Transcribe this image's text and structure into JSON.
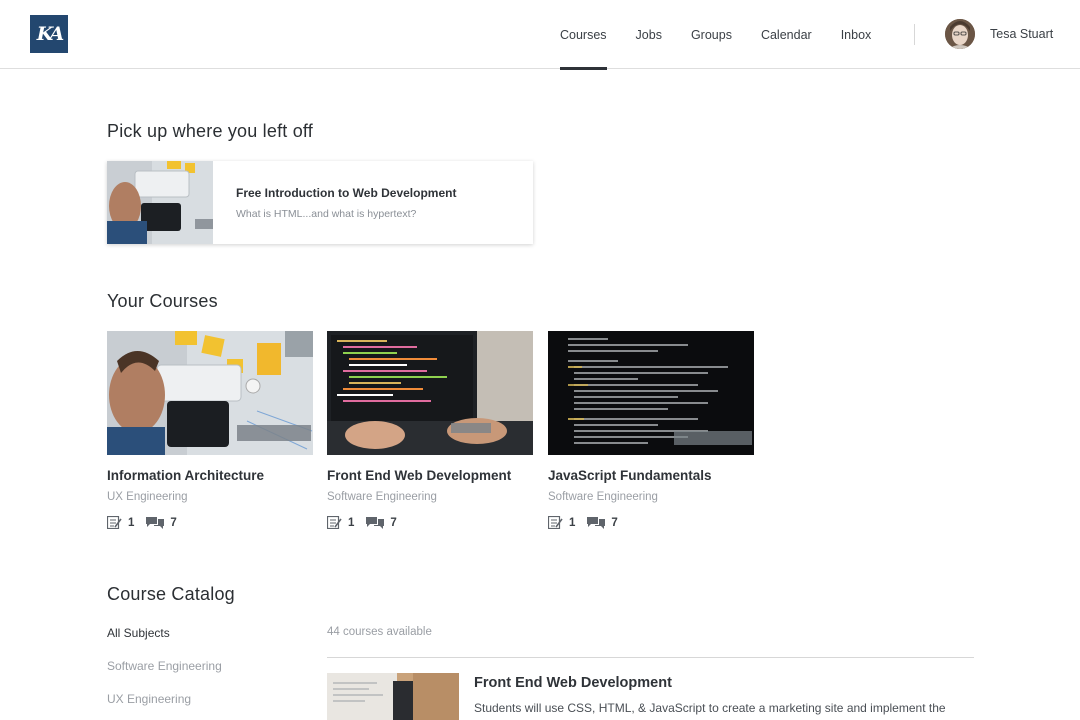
{
  "header": {
    "logo_text": "KA",
    "nav": [
      {
        "label": "Courses",
        "active": true
      },
      {
        "label": "Jobs",
        "active": false
      },
      {
        "label": "Groups",
        "active": false
      },
      {
        "label": "Calendar",
        "active": false
      },
      {
        "label": "Inbox",
        "active": false
      }
    ],
    "user": {
      "name": "Tesa Stuart"
    }
  },
  "resume": {
    "heading": "Pick up where you left off",
    "card": {
      "title": "Free Introduction to Web Development",
      "subtitle": "What is HTML...and what is hypertext?"
    }
  },
  "your_courses": {
    "heading": "Your Courses",
    "courses": [
      {
        "title": "Information Architecture",
        "category": "UX Engineering",
        "assignments": "1",
        "discussions": "7"
      },
      {
        "title": "Front End Web Development",
        "category": "Software Engineering",
        "assignments": "1",
        "discussions": "7"
      },
      {
        "title": "JavaScript Fundamentals",
        "category": "Software Engineering",
        "assignments": "1",
        "discussions": "7"
      }
    ]
  },
  "catalog": {
    "heading": "Course Catalog",
    "subjects": [
      {
        "label": "All Subjects",
        "active": true
      },
      {
        "label": "Software Engineering",
        "active": false
      },
      {
        "label": "UX Engineering",
        "active": false
      }
    ],
    "count_text": "44 courses available",
    "first_course": {
      "title": "Front End Web Development",
      "description": "Students will use CSS, HTML, & JavaScript to create a marketing site and implement the"
    }
  },
  "colors": {
    "brand": "#23476f",
    "text_primary": "#2f3338",
    "text_muted": "#9a9ea4",
    "divider": "#d7d7d7"
  }
}
